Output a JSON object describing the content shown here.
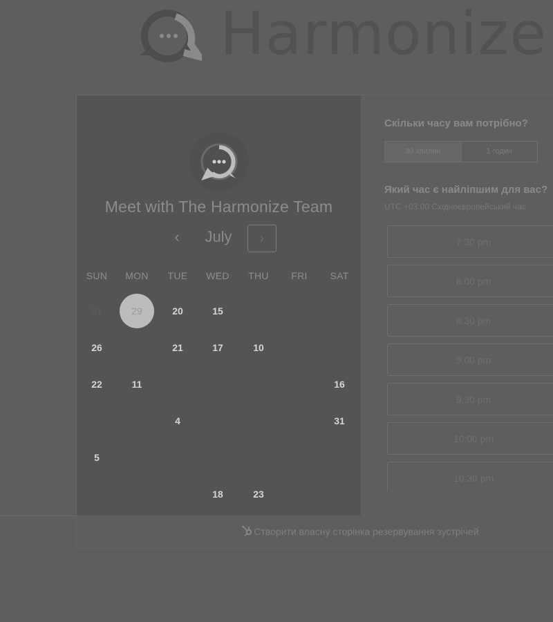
{
  "header": {
    "brand": "Harmonize",
    "logo_icon": "chat-bubble-logo-icon"
  },
  "calendar": {
    "title": "Meet with The Harmonize Team",
    "month": "July",
    "prev_icon": "chevron-left-icon",
    "next_icon": "chevron-right-icon",
    "prev_glyph": "‹",
    "next_glyph": "›",
    "weekdays": [
      "SUN",
      "MON",
      "TUE",
      "WED",
      "THU",
      "FRI",
      "SAT"
    ],
    "weeks": [
      [
        {
          "d": "31",
          "s": "off"
        },
        {
          "d": "29",
          "s": "sel"
        },
        {
          "d": "20",
          "s": "on"
        },
        {
          "d": "15",
          "s": "on"
        },
        {
          "d": "",
          "s": "off"
        },
        {
          "d": "",
          "s": "off"
        },
        {
          "d": "",
          "s": "off"
        }
      ],
      [
        {
          "d": "26",
          "s": "on"
        },
        {
          "d": "",
          "s": "off"
        },
        {
          "d": "21",
          "s": "on"
        },
        {
          "d": "17",
          "s": "on"
        },
        {
          "d": "10",
          "s": "on"
        },
        {
          "d": "",
          "s": "off"
        },
        {
          "d": "",
          "s": "off"
        }
      ],
      [
        {
          "d": "22",
          "s": "on"
        },
        {
          "d": "11",
          "s": "on"
        },
        {
          "d": "",
          "s": "off"
        },
        {
          "d": "",
          "s": "off"
        },
        {
          "d": "",
          "s": "off"
        },
        {
          "d": "",
          "s": "off"
        },
        {
          "d": "16",
          "s": "on"
        }
      ],
      [
        {
          "d": "",
          "s": "off"
        },
        {
          "d": "",
          "s": "off"
        },
        {
          "d": "4",
          "s": "on"
        },
        {
          "d": "",
          "s": "off"
        },
        {
          "d": "",
          "s": "off"
        },
        {
          "d": "",
          "s": "off"
        },
        {
          "d": "31",
          "s": "on"
        }
      ],
      [
        {
          "d": "5",
          "s": "on"
        },
        {
          "d": "",
          "s": "off"
        },
        {
          "d": "",
          "s": "off"
        },
        {
          "d": "",
          "s": "off"
        },
        {
          "d": "",
          "s": "off"
        },
        {
          "d": "",
          "s": "off"
        },
        {
          "d": "",
          "s": "off"
        }
      ],
      [
        {
          "d": "",
          "s": "off"
        },
        {
          "d": "",
          "s": "off"
        },
        {
          "d": "",
          "s": "off"
        },
        {
          "d": "18",
          "s": "on"
        },
        {
          "d": "23",
          "s": "on"
        },
        {
          "d": "",
          "s": "off"
        },
        {
          "d": "",
          "s": "off"
        }
      ]
    ]
  },
  "booking": {
    "duration_question": "Скільки часу вам потрібно?",
    "durations": [
      {
        "label": "30 хвилин",
        "active": true
      },
      {
        "label": "1 годин",
        "active": false
      }
    ],
    "time_question": "Який час є найліпшим для вас?",
    "timezone": "UTC +03:00 Східноєвропейський час",
    "slots": [
      "7:30 pm",
      "8:00 pm",
      "8:30 pm",
      "9:00 pm",
      "9:30 pm",
      "10:00 pm",
      "10:30 pm"
    ]
  },
  "footer": {
    "link": "Створити власну сторінка резервування зустрічей",
    "icon": "hubspot-sprocket-icon"
  },
  "colors": {
    "overlay": "#5e5e5e",
    "panel": "#545454",
    "selected_day": "#bcbcbc"
  }
}
